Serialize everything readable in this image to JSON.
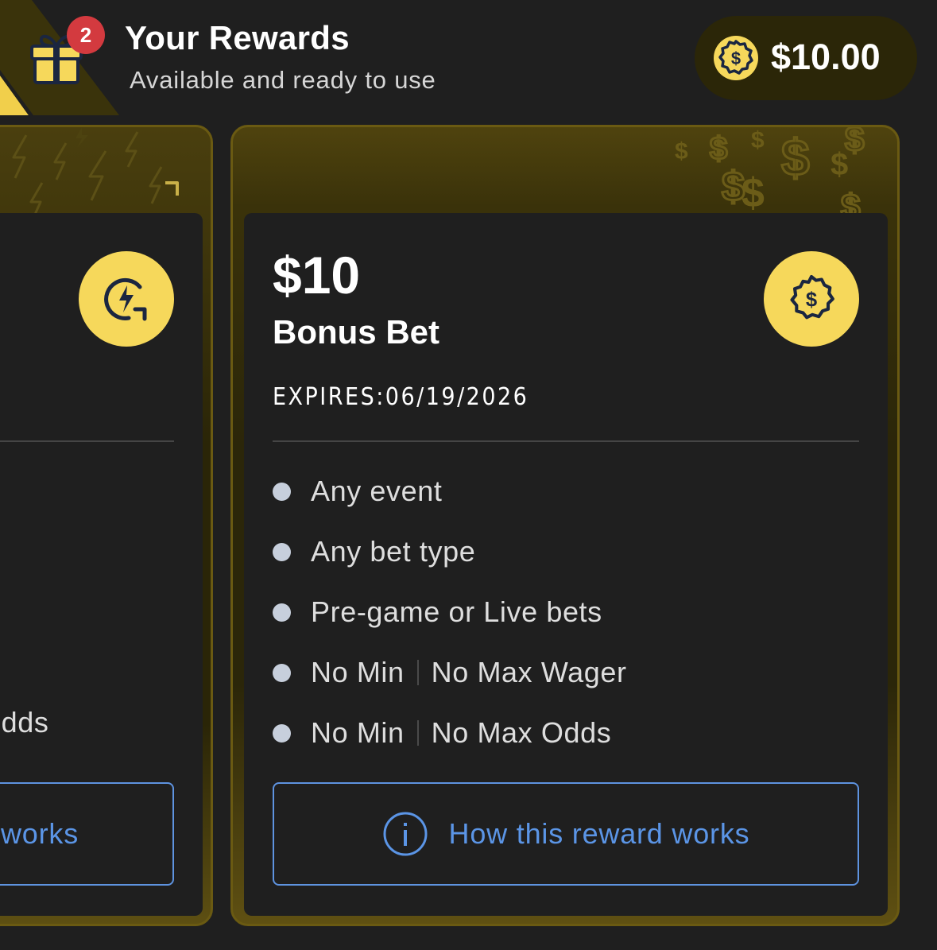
{
  "header": {
    "title": "Your Rewards",
    "subtitle": "Available and ready to use",
    "notification_count": "2",
    "balance": "$10.00",
    "gift_icon": "gift-icon",
    "balance_icon": "dollar-badge-icon"
  },
  "cards": [
    {
      "icon": "lightning-refresh-icon",
      "partial_rule_text": "Odds",
      "partial_button_text": "works"
    },
    {
      "icon": "dollar-badge-icon",
      "amount": "$10",
      "type": "Bonus Bet",
      "expires": "EXPIRES:06/19/2026",
      "rules": [
        {
          "text": "Any event"
        },
        {
          "text": "Any bet type"
        },
        {
          "text": "Pre-game or Live bets"
        },
        {
          "left": "No Min",
          "right": "No Max Wager"
        },
        {
          "left": "No Min",
          "right": "No Max Odds"
        }
      ],
      "button_label": "How this reward works"
    }
  ],
  "colors": {
    "background": "#1f1f1f",
    "gold": "#f6d85b",
    "link_blue": "#5b95e6",
    "badge_red": "#d33a3f"
  }
}
